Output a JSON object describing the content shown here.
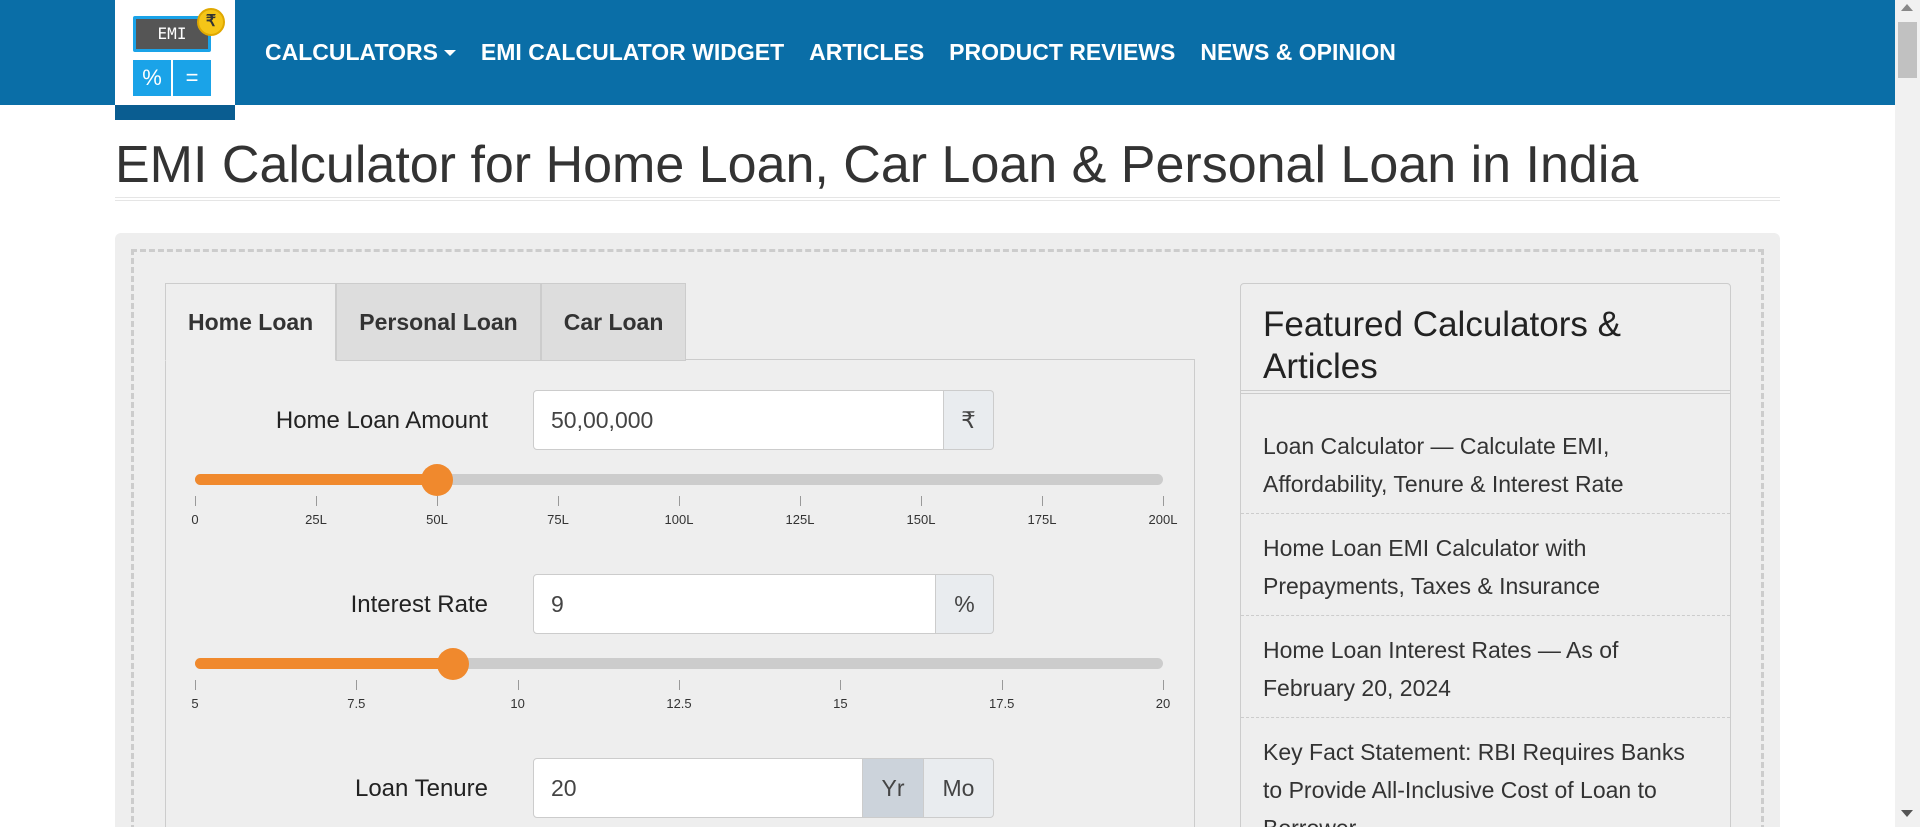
{
  "logo": {
    "screen_text": "EMI",
    "coin_symbol": "₹",
    "key_percent": "%",
    "key_equals": "="
  },
  "nav": {
    "items": [
      "CALCULATORS",
      "EMI CALCULATOR WIDGET",
      "ARTICLES",
      "PRODUCT REVIEWS",
      "NEWS & OPINION"
    ]
  },
  "page_title": "EMI Calculator for Home Loan, Car Loan & Personal Loan in India",
  "tabs": [
    "Home Loan",
    "Personal Loan",
    "Car Loan"
  ],
  "active_tab": "Home Loan",
  "loan_amount": {
    "label": "Home Loan Amount",
    "value": "50,00,000",
    "addon": "₹",
    "slider_fraction": 0.25,
    "ticks": [
      "0",
      "25L",
      "50L",
      "75L",
      "100L",
      "125L",
      "150L",
      "175L",
      "200L"
    ]
  },
  "interest_rate": {
    "label": "Interest Rate",
    "value": "9",
    "addon": "%",
    "slider_fraction": 0.2667,
    "ticks": [
      "5",
      "7.5",
      "10",
      "12.5",
      "15",
      "17.5",
      "20"
    ]
  },
  "loan_tenure": {
    "label": "Loan Tenure",
    "value": "20",
    "unit_year": "Yr",
    "unit_month": "Mo",
    "selected_unit": "Yr"
  },
  "sidebar": {
    "title": "Featured Calculators & Articles",
    "links": [
      "Loan Calculator — Calculate EMI, Affordability, Tenure & Interest Rate",
      "Home Loan EMI Calculator with Prepayments, Taxes & Insurance",
      "Home Loan Interest Rates — As of February 20, 2024",
      "Key Fact Statement: RBI Requires Banks to Provide All-Inclusive Cost of Loan to Borrower"
    ]
  },
  "colors": {
    "navbar": "#0a6ea7",
    "slider_accent": "#f0892d",
    "panel_bg": "#eeeeee"
  }
}
